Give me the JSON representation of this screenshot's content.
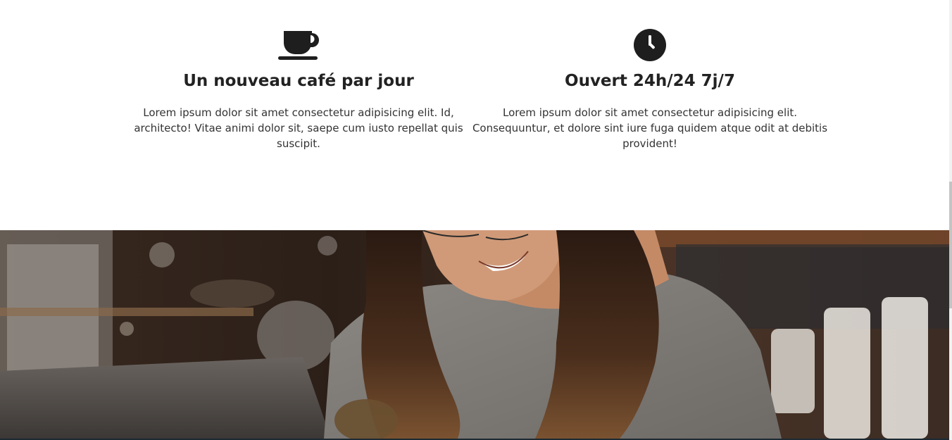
{
  "features": [
    {
      "icon": "coffee-cup-icon",
      "title": "Un nouveau café par jour",
      "text": "Lorem ipsum dolor sit amet consectetur adipisicing elit. Id, architecto! Vitae animi dolor sit, saepe cum iusto repellat quis suscipit."
    },
    {
      "icon": "clock-icon",
      "title": "Ouvert 24h/24 7j/7",
      "text": "Lorem ipsum dolor sit amet consectetur adipisicing elit. Consequuntur, et dolore sint iure fuga quidem atque odit at debitis provident!"
    }
  ],
  "colors": {
    "icon": "#1e1e1e",
    "heading": "#222222",
    "body_text": "#333333"
  }
}
